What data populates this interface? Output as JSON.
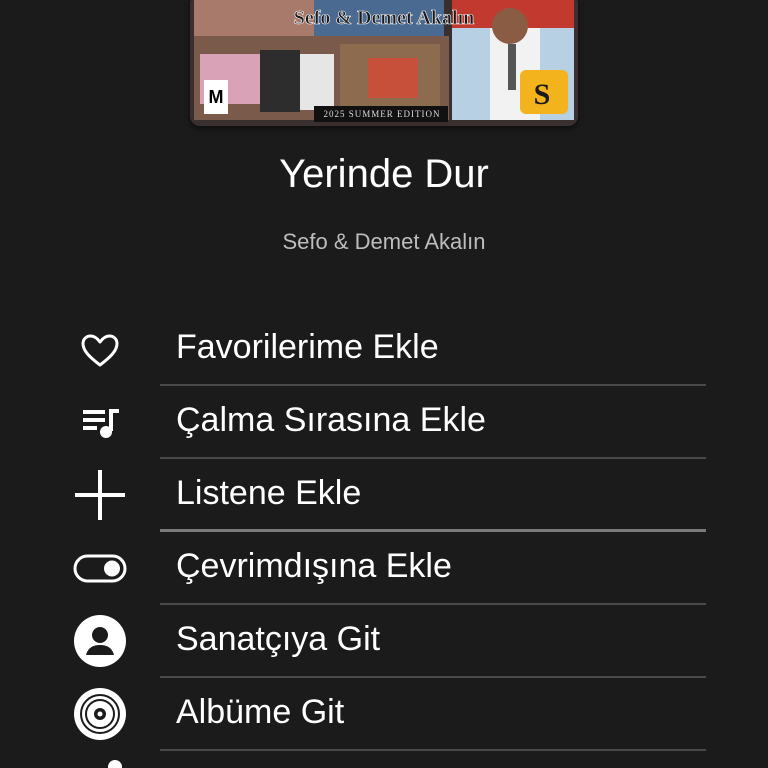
{
  "cover": {
    "title_text": "Sefo & Demet Akalın",
    "edition_text": "2025 SUMMER EDITION",
    "rating_text": "M",
    "logo_text": "S"
  },
  "song": {
    "title": "Yerinde Dur",
    "artist": "Sefo & Demet Akalın"
  },
  "menu": {
    "items": [
      {
        "label": "Favorilerime Ekle",
        "icon": "heart-icon"
      },
      {
        "label": "Çalma Sırasına Ekle",
        "icon": "queue-icon"
      },
      {
        "label": "Listene Ekle",
        "icon": "plus-icon"
      },
      {
        "label": "Çevrimdışına Ekle",
        "icon": "toggle-icon"
      },
      {
        "label": "Sanatçıya Git",
        "icon": "artist-icon"
      },
      {
        "label": "Albüme Git",
        "icon": "album-icon"
      }
    ]
  },
  "colors": {
    "background": "#1b1b1b",
    "text": "#ffffff",
    "subtext": "#bdbdbd",
    "divider": "#4a4a4a"
  }
}
